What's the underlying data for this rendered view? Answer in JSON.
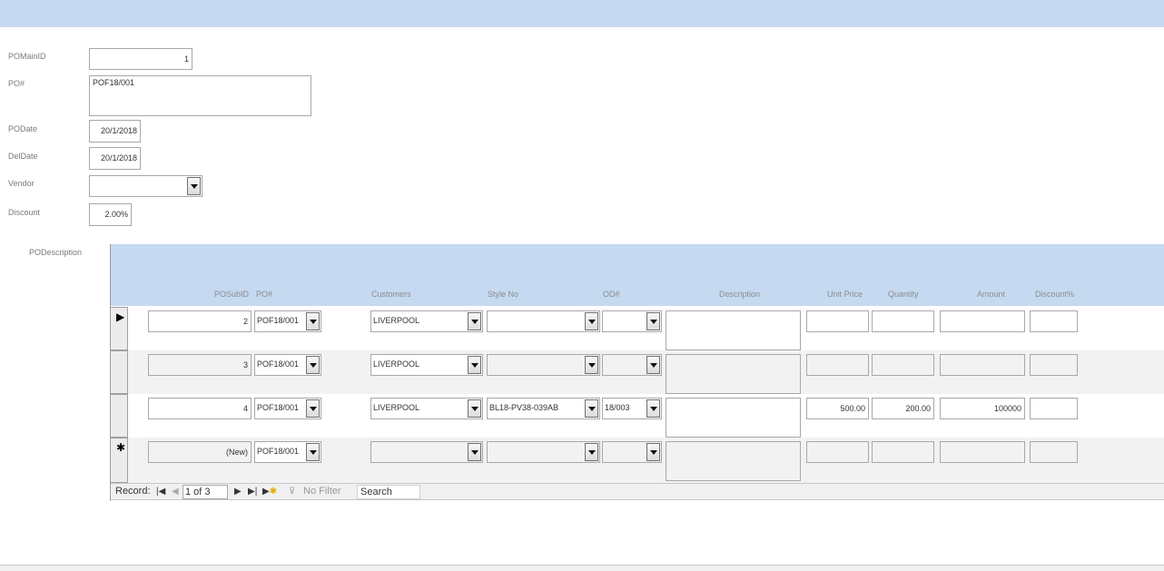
{
  "form": {
    "labels": {
      "pomainid": "POMainID",
      "po": "PO#",
      "podate": "PODate",
      "deldate": "DelDate",
      "vendor": "Vendor",
      "discount": "Discount",
      "podescription": "PODescription"
    },
    "values": {
      "pomainid": "1",
      "po": "POF18/001",
      "podate": "20/1/2018",
      "deldate": "20/1/2018",
      "vendor": "",
      "discount": "2.00%"
    }
  },
  "subform": {
    "columns": {
      "posubid": "POSubID",
      "po": "PO#",
      "customers": "Customers",
      "style_no": "Style No",
      "od": "OD#",
      "description": "Description",
      "unit_price": "Unit Price",
      "quantity": "Quantity",
      "amount": "Amount",
      "discount_pct": "Discount%"
    },
    "rows": [
      {
        "posubid": "2",
        "po": "POF18/001",
        "customers": "LIVERPOOL",
        "style_no": "",
        "od": "",
        "description": "",
        "unit_price": "",
        "quantity": "",
        "amount": "",
        "discount_pct": ""
      },
      {
        "posubid": "3",
        "po": "POF18/001",
        "customers": "LIVERPOOL",
        "style_no": "",
        "od": "",
        "description": "",
        "unit_price": "",
        "quantity": "",
        "amount": "",
        "discount_pct": ""
      },
      {
        "posubid": "4",
        "po": "POF18/001",
        "customers": "LIVERPOOL",
        "style_no": "BL18-PV38-039AB",
        "od": "18/003",
        "description": "",
        "unit_price": "500.00",
        "quantity": "200.00",
        "amount": "100000",
        "discount_pct": ""
      },
      {
        "posubid": "(New)",
        "po": "POF18/001",
        "customers": "",
        "style_no": "",
        "od": "",
        "description": "",
        "unit_price": "",
        "quantity": "",
        "amount": "",
        "discount_pct": ""
      }
    ],
    "row_markers": [
      "▶",
      "",
      "",
      "✱"
    ],
    "nav": {
      "record_label": "Record:",
      "record_value": "1 of 3",
      "filter_label": "No Filter",
      "search_placeholder": "Search"
    }
  }
}
